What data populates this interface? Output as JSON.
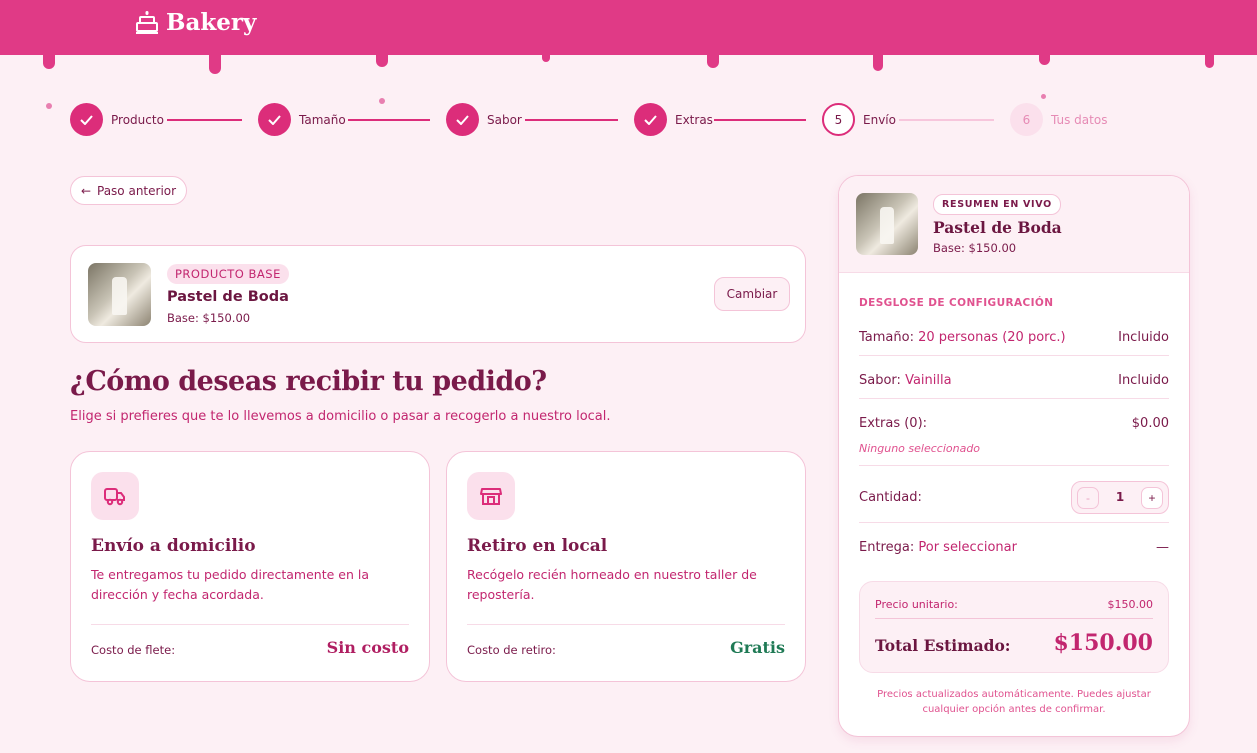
{
  "brand": {
    "name": "Bakery"
  },
  "stepper": {
    "steps": [
      {
        "label": "Producto",
        "state": "done",
        "number": ""
      },
      {
        "label": "Tamaño",
        "state": "done",
        "number": ""
      },
      {
        "label": "Sabor",
        "state": "done",
        "number": ""
      },
      {
        "label": "Extras",
        "state": "done",
        "number": ""
      },
      {
        "label": "Envío",
        "state": "current",
        "number": "5"
      },
      {
        "label": "Tus datos",
        "state": "todo",
        "number": "6"
      }
    ]
  },
  "back_button": {
    "label": "Paso anterior",
    "arrow": "←"
  },
  "product_card": {
    "badge": "PRODUCTO BASE",
    "name": "Pastel de Boda",
    "base": "Base: $150.00",
    "change_label": "Cambiar"
  },
  "main": {
    "heading": "¿Cómo deseas recibir tu pedido?",
    "subheading": "Elige si prefieres que te lo llevemos a domicilio o pasar a recogerlo a nuestro local."
  },
  "options": [
    {
      "icon": "delivery-truck-icon",
      "title": "Envío a domicilio",
      "description": "Te entregamos tu pedido directamente en la dirección y fecha acordada.",
      "cost_label": "Costo de flete:",
      "cost_value": "Sin costo",
      "cost_color": "#b01f62"
    },
    {
      "icon": "store-icon",
      "title": "Retiro en local",
      "description": "Recógelo recién horneado en nuestro taller de repostería.",
      "cost_label": "Costo de retiro:",
      "cost_value": "Gratis",
      "cost_color": "#1f7a55"
    }
  ],
  "summary": {
    "badge": "RESUMEN EN VIVO",
    "product_name": "Pastel de Boda",
    "base": "Base: $150.00",
    "section_title": "DESGLOSE DE CONFIGURACIÓN",
    "rows": {
      "size_key": "Tamaño:",
      "size_val": "20 personas (20 porc.)",
      "size_price": "Incluido",
      "flavor_key": "Sabor:",
      "flavor_val": "Vainilla",
      "flavor_price": "Incluido",
      "extras_key": "Extras (0):",
      "extras_price": "$0.00",
      "extras_none": "Ninguno seleccionado",
      "qty_key": "Cantidad:",
      "qty_minus": "-",
      "qty_value": "1",
      "qty_plus": "+",
      "delivery_key": "Entrega:",
      "delivery_val": "Por seleccionar",
      "delivery_price": "—"
    },
    "unit_label": "Precio unitario:",
    "unit_value": "$150.00",
    "total_label": "Total Estimado:",
    "total_value": "$150.00",
    "footnote": "Precios actualizados automáticamente. Puedes ajustar cualquier opción antes de confirmar."
  },
  "colors": {
    "brand": "#e03a86",
    "accent": "#dc2d7a",
    "text": "#7a1a4a",
    "background": "#fdf0f5"
  }
}
